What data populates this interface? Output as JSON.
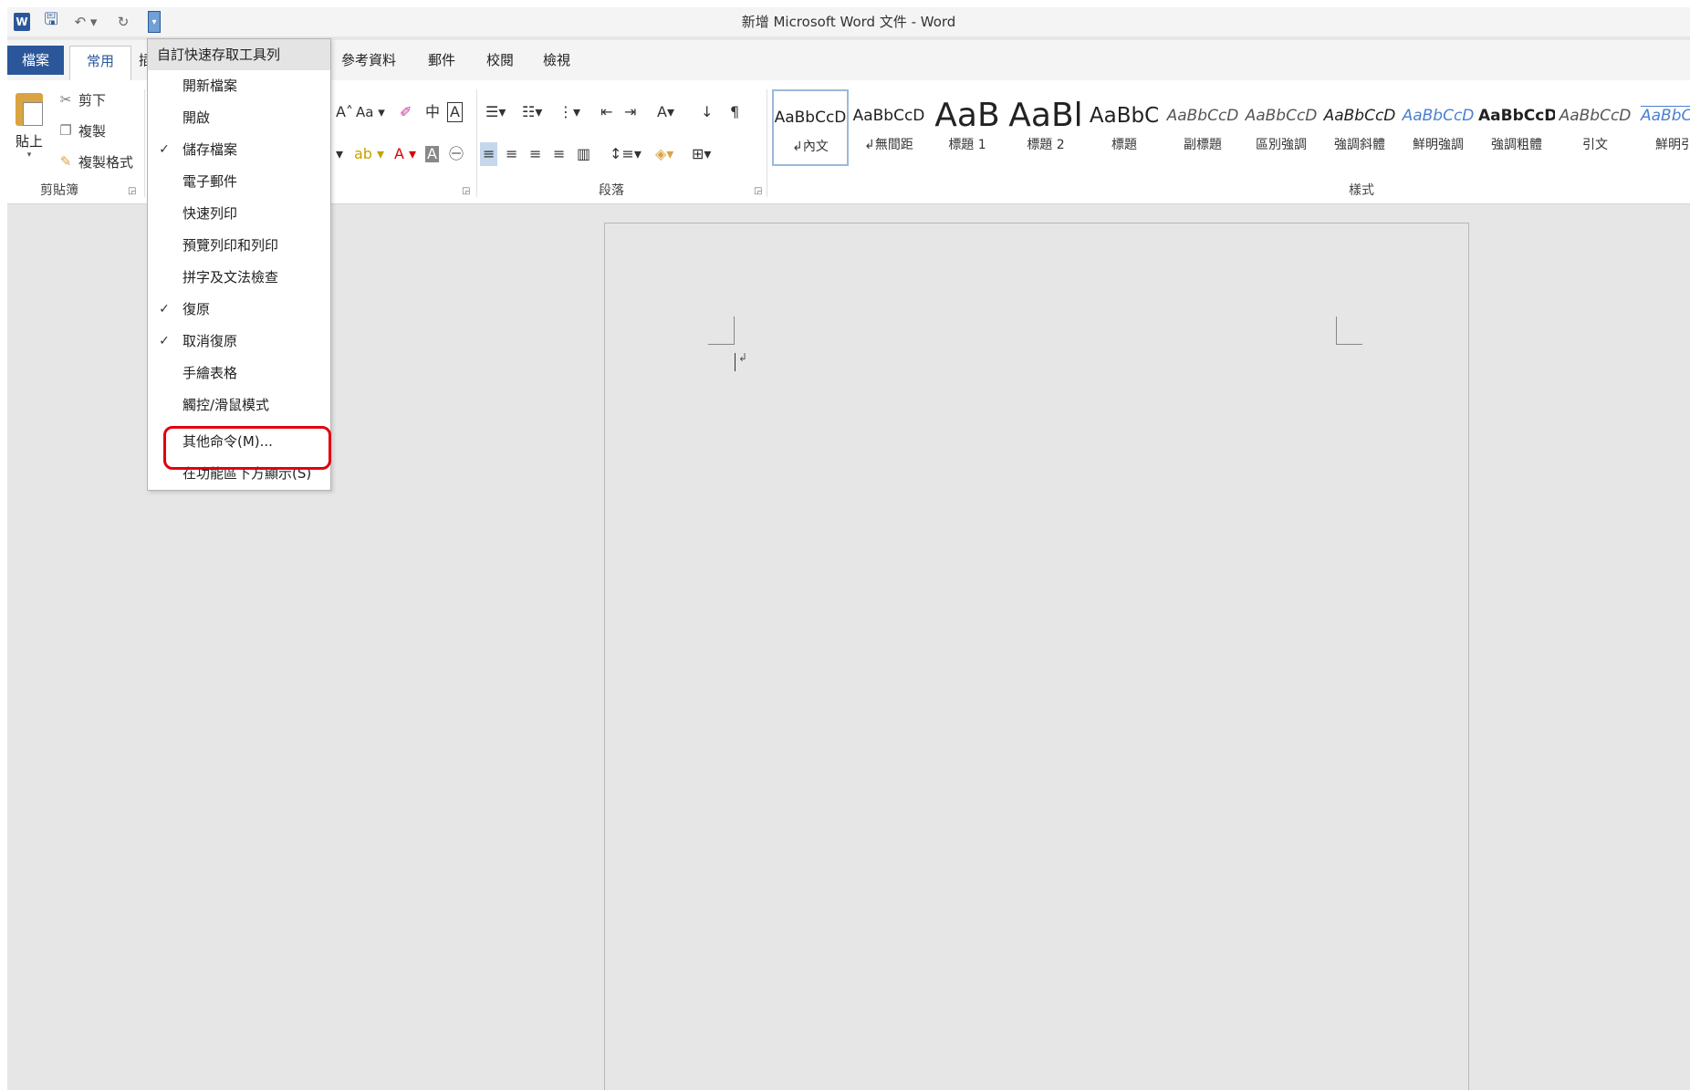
{
  "window": {
    "title": "新增 Microsoft Word 文件 - Word"
  },
  "qat": {
    "word_icon": "W",
    "icons": {
      "app": "word-icon",
      "save": "save-icon",
      "undo": "undo-icon",
      "redo": "redo-icon",
      "customize": "dropdown-arrow-icon"
    }
  },
  "tabs": {
    "file": "檔案",
    "home": "常用",
    "insert_stub": "插",
    "references": "參考資料",
    "mailings": "郵件",
    "review": "校閱",
    "view": "檢視"
  },
  "ribbon": {
    "clipboard": {
      "paste": "貼上",
      "cut": "剪下",
      "copy": "複製",
      "format_painter": "複製格式",
      "group_label": "剪貼簿"
    },
    "font": {
      "change_case": "Aa"
    },
    "paragraph": {
      "group_label": "段落"
    },
    "styles": {
      "group_label": "樣式",
      "items": [
        {
          "sample": "AaBbCcD",
          "name": "↲內文"
        },
        {
          "sample": "AaBbCcD",
          "name": "↲無間距"
        },
        {
          "sample": "AaB",
          "name": "標題 1"
        },
        {
          "sample": "AaBl",
          "name": "標題 2"
        },
        {
          "sample": "AaBbC",
          "name": "標題"
        },
        {
          "sample": "AaBbCcD",
          "name": "副標題"
        },
        {
          "sample": "AaBbCcD",
          "name": "區別強調"
        },
        {
          "sample": "AaBbCcD",
          "name": "強調斜體"
        },
        {
          "sample": "AaBbCcD",
          "name": "鮮明強調"
        },
        {
          "sample": "AaBbCcD",
          "name": "強調粗體"
        },
        {
          "sample": "AaBbCcD",
          "name": "引文"
        },
        {
          "sample": "AaBbC",
          "name": "鮮明引"
        }
      ]
    }
  },
  "qat_menu": {
    "header": "自訂快速存取工具列",
    "items": [
      {
        "label": "開新檔案",
        "checked": ""
      },
      {
        "label": "開啟",
        "checked": ""
      },
      {
        "label": "儲存檔案",
        "checked": "✓"
      },
      {
        "label": "電子郵件",
        "checked": ""
      },
      {
        "label": "快速列印",
        "checked": ""
      },
      {
        "label": "預覽列印和列印",
        "checked": ""
      },
      {
        "label": "拼字及文法檢查",
        "checked": ""
      },
      {
        "label": "復原",
        "checked": "✓"
      },
      {
        "label": "取消復原",
        "checked": "✓"
      },
      {
        "label": "手繪表格",
        "checked": ""
      },
      {
        "label": "觸控/滑鼠模式",
        "checked": ""
      },
      {
        "label": "其他命令(M)...",
        "checked": ""
      },
      {
        "label": "在功能區下方顯示(S)",
        "checked": ""
      }
    ]
  },
  "colors": {
    "accent": "#2b579a",
    "highlight": "#e00010"
  }
}
